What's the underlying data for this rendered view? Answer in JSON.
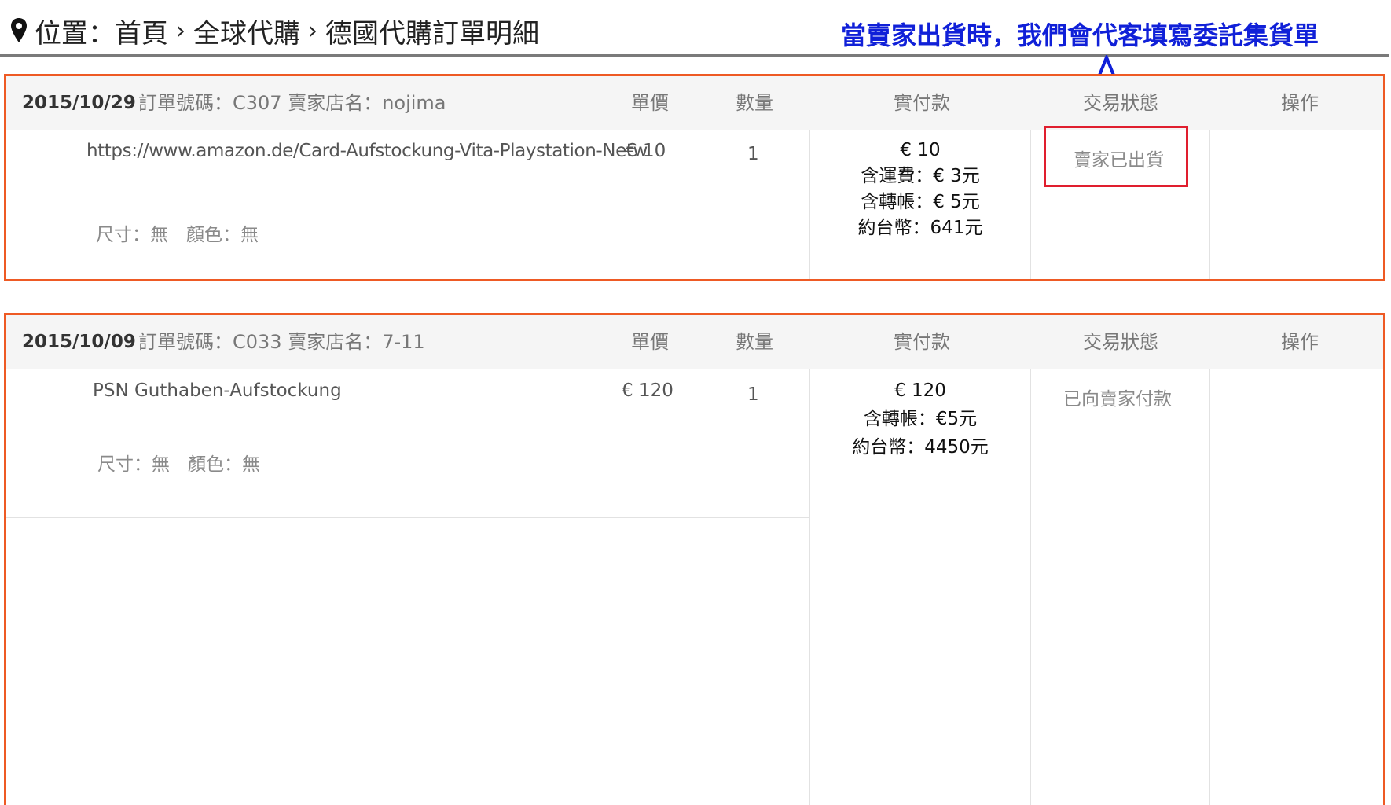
{
  "breadcrumb": {
    "prefix": "位置：",
    "items": [
      "首頁",
      "全球代購",
      "德國代購訂單明細"
    ],
    "separator": "›"
  },
  "annotation": {
    "text": "當賣家出貨時，我們會代客填寫委託集貨單",
    "color": "#1020d8"
  },
  "columns": {
    "unit_price": "單價",
    "quantity": "數量",
    "paid": "實付款",
    "status": "交易狀態",
    "action": "操作"
  },
  "orders": [
    {
      "date": "2015/10/29",
      "meta": "訂單號碼：C307 賣家店名：nojima",
      "item": {
        "name": "https://www.amazon.de/Card-Aufstockung-Vita-Playstation-Netw",
        "options": "尺寸：無　顏色：無",
        "unit_price": "€ 10",
        "quantity": "1"
      },
      "payment": [
        "€ 10",
        "含運費：€ 3元",
        "含轉帳：€ 5元",
        "約台幣：641元"
      ],
      "status": "賣家已出貨"
    },
    {
      "date": "2015/10/09",
      "meta": "訂單號碼：C033 賣家店名：7-11",
      "item": {
        "name": "PSN Guthaben-Aufstockung",
        "options": "尺寸：無　顏色：無",
        "unit_price": "€ 120",
        "quantity": "1"
      },
      "payment": [
        "€ 120",
        "含轉帳：€5元",
        "約台幣：4450元"
      ],
      "status": "已向賣家付款"
    }
  ],
  "colors": {
    "order_border": "#ee5a24",
    "highlight_box": "#e01e2e",
    "header_bg": "#f5f5f5"
  }
}
